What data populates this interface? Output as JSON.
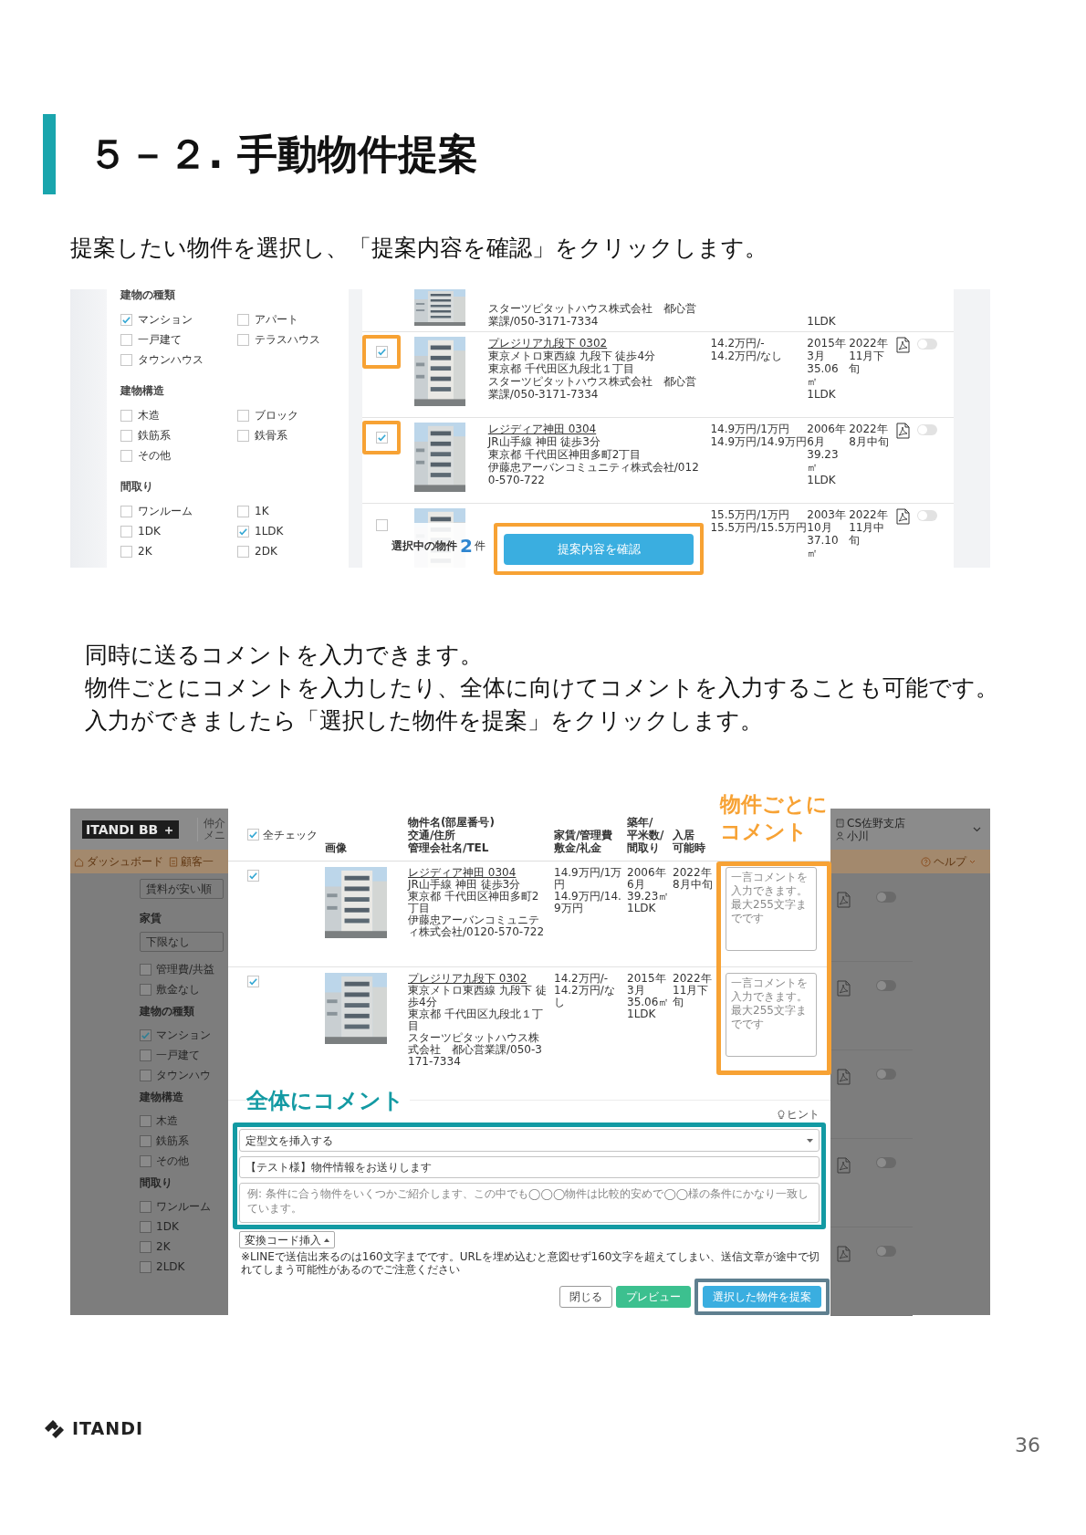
{
  "heading": "５－２. 手動物件提案",
  "intro": "提案したい物件を選択し、「提案内容を確認」をクリックします。",
  "screenshot_1": {
    "filter_groups": [
      {
        "title": "建物の種類",
        "options": [
          {
            "label": "マンション",
            "checked": true
          },
          {
            "label": "アパート",
            "checked": false
          },
          {
            "label": "一戸建て",
            "checked": false
          },
          {
            "label": "テラスハウス",
            "checked": false
          },
          {
            "label": "タウンハウス",
            "checked": false
          }
        ]
      },
      {
        "title": "建物構造",
        "options": [
          {
            "label": "木造",
            "checked": false
          },
          {
            "label": "ブロック",
            "checked": false
          },
          {
            "label": "鉄筋系",
            "checked": false
          },
          {
            "label": "鉄骨系",
            "checked": false
          },
          {
            "label": "その他",
            "checked": false
          }
        ]
      },
      {
        "title": "間取り",
        "options": [
          {
            "label": "ワンルーム",
            "checked": false
          },
          {
            "label": "1K",
            "checked": false
          },
          {
            "label": "1DK",
            "checked": false
          },
          {
            "label": "1LDK",
            "checked": true
          },
          {
            "label": "2K",
            "checked": false
          },
          {
            "label": "2DK",
            "checked": false
          }
        ]
      }
    ],
    "results": [
      {
        "kind": "partial",
        "details": [
          "スターツピタットハウス株式会社　都心営業課/050-3171-7334"
        ],
        "specs": [
          "1LDK"
        ]
      },
      {
        "kind": "full",
        "checked": true,
        "highlighted": true,
        "name": "プレジリア九段下 0302",
        "details": [
          "東京メトロ東西線 九段下 徒歩4分",
          "東京都 千代田区九段北１丁目",
          "スターツピタットハウス株式会社　都心営業課/050-3171-7334"
        ],
        "rent": [
          "14.2万円/-",
          "14.2万円/なし"
        ],
        "specs": [
          "2015年3月",
          "35.06㎡",
          "1LDK"
        ],
        "move_in": [
          "2022年11月下旬"
        ],
        "toggle_on": false
      },
      {
        "kind": "full",
        "checked": true,
        "highlighted": true,
        "name": "レジディア神田 0304",
        "details": [
          "JR山手線 神田 徒歩3分",
          "東京都 千代田区神田多町2丁目",
          "伊藤忠アーバンコミュニティ株式会社/0120-570-722"
        ],
        "rent": [
          "14.9万円/1万円",
          "14.9万円/14.9万円"
        ],
        "specs": [
          "2006年6月",
          "39.23㎡",
          "1LDK"
        ],
        "move_in": [
          "2022年8月中旬"
        ],
        "toggle_on": false
      },
      {
        "kind": "full",
        "checked": false,
        "highlighted": false,
        "rent": [
          "15.5万円/1万円",
          "15.5万円/15.5万円"
        ],
        "specs": [
          "2003年10月",
          "37.10㎡"
        ],
        "move_in": [
          "2022年11月中旬"
        ],
        "toggle_on": false
      }
    ],
    "selection_label": "選択中の物件",
    "selection_count": "2",
    "selection_unit": "件",
    "confirm_button": "提案内容を確認"
  },
  "instructions": [
    "同時に送るコメントを入力できます。",
    "物件ごとにコメントを入力したり、全体に向けてコメントを入力することも可能です。",
    "入力ができましたら「選択した物件を提案」をクリックします。"
  ],
  "screenshot_2": {
    "logo": "ITANDI BB ＋",
    "menu_hint": [
      "仲介",
      "メニ"
    ],
    "nav": [
      "ダッシュボード",
      "顧客一"
    ],
    "branch": "CS佐野支店",
    "user": "小川",
    "help": "ヘルプ",
    "sidebar": [
      {
        "kind": "select",
        "value": "賃料が安い順"
      },
      {
        "kind": "heading",
        "text": "家賃"
      },
      {
        "kind": "select",
        "value": "下限なし"
      },
      {
        "kind": "checkbox",
        "label": "管理費/共益",
        "checked": false
      },
      {
        "kind": "checkbox",
        "label": "敷金なし",
        "checked": false
      },
      {
        "kind": "heading",
        "text": "建物の種類"
      },
      {
        "kind": "checkbox",
        "label": "マンション",
        "checked": true
      },
      {
        "kind": "checkbox",
        "label": "一戸建て",
        "checked": false
      },
      {
        "kind": "checkbox",
        "label": "タウンハウ",
        "checked": false
      },
      {
        "kind": "heading",
        "text": "建物構造"
      },
      {
        "kind": "checkbox",
        "label": "木造",
        "checked": false
      },
      {
        "kind": "checkbox",
        "label": "鉄筋系",
        "checked": false
      },
      {
        "kind": "checkbox",
        "label": "その他",
        "checked": false
      },
      {
        "kind": "heading",
        "text": "間取り"
      },
      {
        "kind": "checkbox",
        "label": "ワンルーム",
        "checked": false
      },
      {
        "kind": "checkbox",
        "label": "1DK",
        "checked": false
      },
      {
        "kind": "checkbox",
        "label": "2K",
        "checked": false
      },
      {
        "kind": "checkbox",
        "label": "2LDK",
        "checked": false
      }
    ],
    "select_all": {
      "label": "全チェック",
      "checked": true
    },
    "columns": [
      {
        "lines": [
          "画像"
        ]
      },
      {
        "lines": [
          "物件名(部屋番号)",
          "交通/住所",
          "管理会社名/TEL"
        ]
      },
      {
        "lines": [
          "家賃/管理費",
          "敷金/礼金"
        ]
      },
      {
        "lines": [
          "築年/",
          "平米数/",
          "間取り"
        ]
      },
      {
        "lines": [
          "入居",
          "可能時"
        ]
      }
    ],
    "rows": [
      {
        "checked": true,
        "name": "レジディア神田 0304",
        "details": [
          "JR山手線 神田 徒歩3分",
          "東京都 千代田区神田多町2丁目",
          "伊藤忠アーバンコミュニティ株式会社/0120-570-722"
        ],
        "rent": [
          "14.9万円/1万円",
          "14.9万円/14.9万円"
        ],
        "specs": [
          "2006年6月",
          "39.23㎡",
          "1LDK"
        ],
        "move_in": [
          "2022年8月中旬"
        ],
        "comment_placeholder": "一言コメントを入力できます。最大255文字までです"
      },
      {
        "checked": true,
        "name": "プレジリア九段下 0302",
        "details": [
          "東京メトロ東西線 九段下 徒歩4分",
          "東京都 千代田区九段北１丁目",
          "スターツピタットハウス株式会社　都心営業課/050-3171-7334"
        ],
        "rent": [
          "14.2万円/-",
          "14.2万円/なし"
        ],
        "specs": [
          "2015年3月",
          "35.06㎡",
          "1LDK"
        ],
        "move_in": [
          "2022年11月下旬"
        ],
        "comment_placeholder": "一言コメントを入力できます。最大255文字までです"
      }
    ],
    "side_rows": [
      {
        "toggle_on": false
      },
      {
        "toggle_on": false
      },
      {
        "toggle_on": false
      },
      {
        "toggle_on": false
      },
      {
        "toggle_on": false
      }
    ],
    "per_property_note": [
      "物件ごとに",
      "コメント"
    ],
    "overall_note": "全体にコメント",
    "hint": "ヒント",
    "template_select": "定型文を挿入する",
    "subject": "【テスト様】物件情報をお送りします",
    "message_placeholder": "例: 条件に合う物件をいくつかご紹介します、この中でも◯◯◯物件は比較的安めで◯◯様の条件にかなり一致しています。",
    "convert_button": "変換コード挿入",
    "notice": "※LINEで送信出来るのは160文字までです。URLを埋め込むと意図せず160文字を超えてしまい、送信文章が途中で切れてしまう可能性があるのでご注意ください",
    "buttons": [
      {
        "kind": "secondary",
        "label": "閉じる"
      },
      {
        "kind": "preview",
        "label": "プレビュー"
      },
      {
        "kind": "primary",
        "label": "選択した物件を提案"
      }
    ]
  },
  "footer": {
    "logo": "ITANDI",
    "page": "36"
  }
}
